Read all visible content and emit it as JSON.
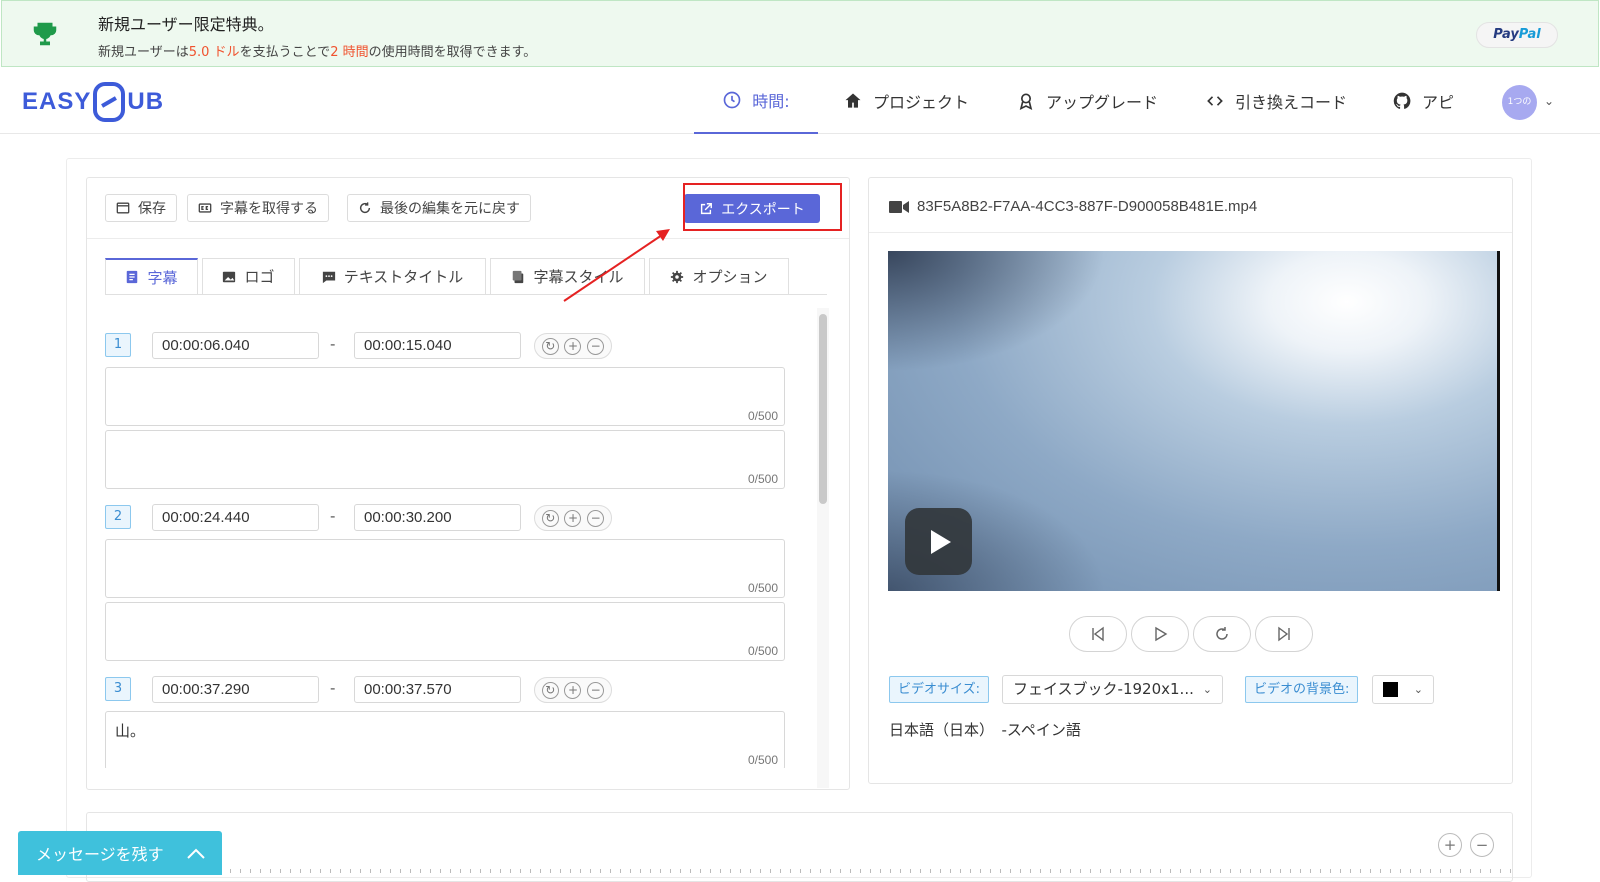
{
  "promo": {
    "title": "新規ユーザー限定特典。",
    "desc_prefix": "新規ユーザーは",
    "desc_amount": "5.0 ドル",
    "desc_mid": "を支払うことで",
    "desc_hours": "2 時間",
    "desc_suffix": "の使用時間を取得できます。",
    "paypal_part1": "Pay",
    "paypal_part2": "Pal"
  },
  "header": {
    "logo_left": "EASY",
    "logo_right": "UB",
    "nav": [
      "時間:",
      "プロジェクト",
      "アップグレード",
      "引き換えコード",
      "アピ"
    ],
    "avatar_text": "1つの"
  },
  "toolbar": {
    "save": "保存",
    "get_subtitles": "字幕を取得する",
    "undo": "最後の編集を元に戻す",
    "export": "エクスポート"
  },
  "tabs": [
    "字幕",
    "ロゴ",
    "テキストタイトル",
    "字幕スタイル",
    "オプション"
  ],
  "entries": [
    {
      "num": "1",
      "start": "00:00:06.040",
      "end": "00:00:15.040",
      "text1": "",
      "text2": "",
      "count1": "0/500",
      "count2": "0/500"
    },
    {
      "num": "2",
      "start": "00:00:24.440",
      "end": "00:00:30.200",
      "text1": "",
      "text2": "",
      "count1": "0/500",
      "count2": "0/500"
    },
    {
      "num": "3",
      "start": "00:00:37.290",
      "end": "00:00:37.570",
      "text1": "山。",
      "count1": "0/500"
    }
  ],
  "dash": "-",
  "video": {
    "filename": "83F5A8B2-F7AA-4CC3-887F-D900058B481E.mp4",
    "size_label": "ビデオサイズ:",
    "size_value": "フェイスブック-1920x1...",
    "bg_label": "ビデオの背景色:",
    "bg_color": "#000000",
    "language_line": "日本語（日本）　-スペイン語"
  },
  "message_button": "メッセージを残す",
  "colors": {
    "accent": "#5a67d8",
    "highlight": "#e52222",
    "promo_bg": "#eef9ef",
    "message": "#3fc1dc"
  }
}
